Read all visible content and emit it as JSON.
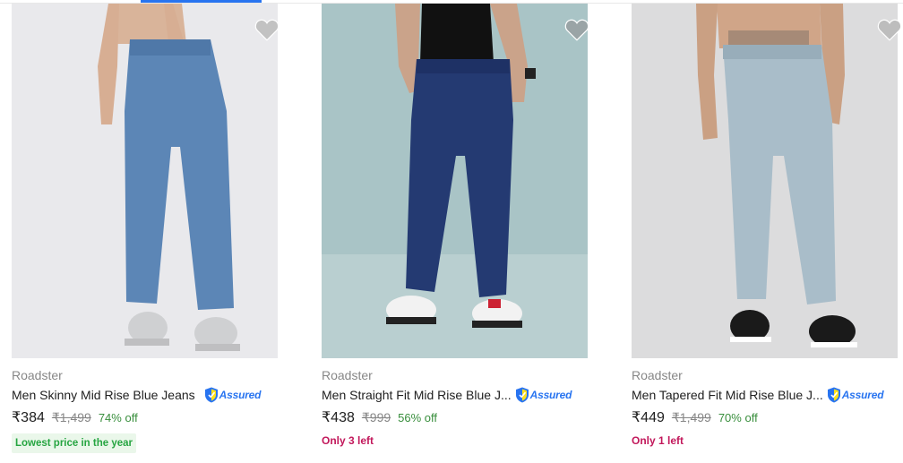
{
  "products": [
    {
      "brand": "Roadster",
      "title": "Men Skinny Mid Rise Blue Jeans",
      "assured": "Assured",
      "price": "₹384",
      "mrp": "₹1,499",
      "discount": "74% off",
      "tag": "Lowest price in the year",
      "wishlist_icon": "heart-icon",
      "image": {
        "background": "#e9e9ec",
        "jeans_color": "#5c86b6",
        "shoe_color": "#cfd0d2"
      }
    },
    {
      "brand": "Roadster",
      "title": "Men Straight Fit Mid Rise Blue J...",
      "assured": "Assured",
      "price": "₹438",
      "mrp": "₹999",
      "discount": "56% off",
      "tag": "Only 3 left",
      "wishlist_icon": "heart-icon",
      "image": {
        "background": "#a9c4c6",
        "jeans_color": "#243a72",
        "shoe_color": "#f2f2f2"
      }
    },
    {
      "brand": "Roadster",
      "title": "Men Tapered Fit Mid Rise Blue J...",
      "assured": "Assured",
      "price": "₹449",
      "mrp": "₹1,499",
      "discount": "70% off",
      "tag": "Only 1 left",
      "wishlist_icon": "heart-icon",
      "image": {
        "background": "#dcdcdd",
        "jeans_color": "#a9bdc9",
        "shoe_color": "#1a1a1a"
      }
    }
  ],
  "colors": {
    "assured_blue": "#2874f0",
    "discount_green": "#388e3c",
    "stock_magenta": "#c2185b",
    "brand_gray": "#878787"
  }
}
